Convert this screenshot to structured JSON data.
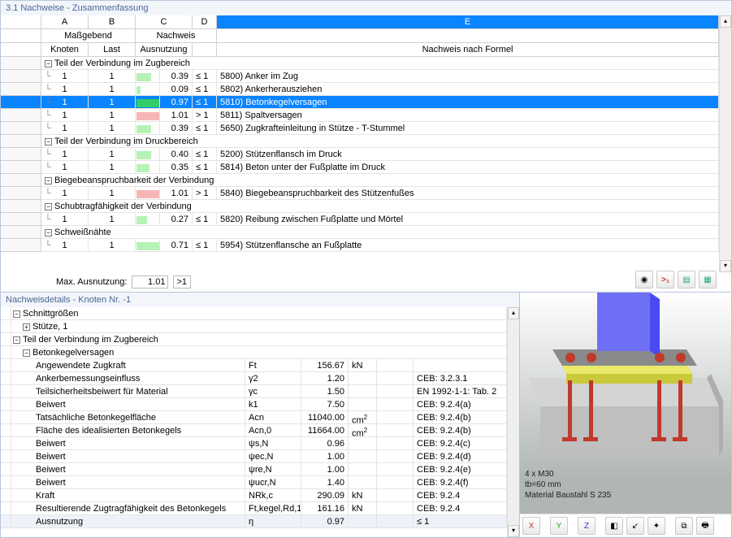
{
  "title": "3.1 Nachweise - Zusammenfassung",
  "cols": {
    "A": "A",
    "B": "B",
    "C": "C",
    "D": "D",
    "E": "E",
    "MaBgebend": "Maßgebend",
    "Nachweis": "Nachweis",
    "Knoten": "Knoten",
    "Last": "Last",
    "Ausnutzung": "Ausnutzung",
    "Formel": "Nachweis nach Formel"
  },
  "groups": [
    {
      "title": "Teil der Verbindung im Zugbereich",
      "rows": [
        {
          "k": "1",
          "l": "1",
          "r": "0.39",
          "c": "≤ 1",
          "d": "5800) Anker im Zug",
          "bar": "green",
          "bw": 18
        },
        {
          "k": "1",
          "l": "1",
          "r": "0.09",
          "c": "≤ 1",
          "d": "5802) Ankerherausziehen",
          "bar": "green",
          "bw": 5
        },
        {
          "k": "1",
          "l": "1",
          "r": "0.97",
          "c": "≤ 1",
          "d": "5810) Betonkegelversagen",
          "bar": "hgreen",
          "bw": 36,
          "sel": true
        },
        {
          "k": "1",
          "l": "1",
          "r": "1.01",
          "c": "> 1",
          "d": "5811) Spaltversagen",
          "bar": "red",
          "bw": 38
        },
        {
          "k": "1",
          "l": "1",
          "r": "0.39",
          "c": "≤ 1",
          "d": "5650) Zugkrafteinleitung in Stütze - T-Stummel",
          "bar": "green",
          "bw": 18
        }
      ]
    },
    {
      "title": "Teil der Verbindung im Druckbereich",
      "rows": [
        {
          "k": "1",
          "l": "1",
          "r": "0.40",
          "c": "≤ 1",
          "d": "5200) Stützenflansch im Druck",
          "bar": "green",
          "bw": 18
        },
        {
          "k": "1",
          "l": "1",
          "r": "0.35",
          "c": "≤ 1",
          "d": "5814) Beton unter der Fußplatte im Druck",
          "bar": "green",
          "bw": 16
        }
      ]
    },
    {
      "title": "Biegebeanspruchbarkeit der Verbindung",
      "rows": [
        {
          "k": "1",
          "l": "1",
          "r": "1.01",
          "c": "> 1",
          "d": "5840) Biegebeanspruchbarkeit des Stützenfußes",
          "bar": "red",
          "bw": 38
        }
      ]
    },
    {
      "title": "Schubtragfähigkeit der Verbindung",
      "rows": [
        {
          "k": "1",
          "l": "1",
          "r": "0.27",
          "c": "≤ 1",
          "d": "5820) Reibung zwischen Fußplatte und Mörtel",
          "bar": "green",
          "bw": 13
        }
      ]
    },
    {
      "title": "Schweißnähte",
      "rows": [
        {
          "k": "1",
          "l": "1",
          "r": "0.71",
          "c": "≤ 1",
          "d": "5954) Stützenflansche an Fußplatte",
          "bar": "green",
          "bw": 30
        }
      ]
    }
  ],
  "max": {
    "label": "Max. Ausnutzung:",
    "val": "1.01",
    "cmp": ">1"
  },
  "details": {
    "title": "Nachweisdetails - Knoten Nr. -1",
    "groups": [
      {
        "h": "Schnittgrößen",
        "rows": [
          {
            "h": "Stütze, 1",
            "tog": "+"
          }
        ]
      },
      {
        "h": "Teil der Verbindung im Zugbereich",
        "rows": []
      },
      {
        "h": "Betonkegelversagen",
        "indent": 1,
        "rows": [
          {
            "n": "Angewendete Zugkraft",
            "s": "Ft",
            "v": "156.67",
            "u": "kN",
            "r": ""
          },
          {
            "n": "Ankerbemessungseinfluss",
            "s": "γ2",
            "v": "1.20",
            "u": "",
            "r": "CEB: 3.2.3.1"
          },
          {
            "n": "Teilsicherheitsbeiwert für Material",
            "s": "γc",
            "v": "1.50",
            "u": "",
            "r": "EN 1992-1-1: Tab. 2"
          },
          {
            "n": "Beiwert",
            "s": "k1",
            "v": "7.50",
            "u": "",
            "r": "CEB: 9.2.4(a)"
          },
          {
            "n": "Tatsächliche Betonkegelfläche",
            "s": "Acn",
            "v": "11040.00",
            "u": "cm²",
            "r": "CEB: 9.2.4(b)"
          },
          {
            "n": "Fläche des idealisierten Betonkegels",
            "s": "Acn,0",
            "v": "11664.00",
            "u": "cm²",
            "r": "CEB: 9.2.4(b)"
          },
          {
            "n": "Beiwert",
            "s": "ψs,N",
            "v": "0.96",
            "u": "",
            "r": "CEB: 9.2.4(c)"
          },
          {
            "n": "Beiwert",
            "s": "ψec,N",
            "v": "1.00",
            "u": "",
            "r": "CEB: 9.2.4(d)"
          },
          {
            "n": "Beiwert",
            "s": "ψre,N",
            "v": "1.00",
            "u": "",
            "r": "CEB: 9.2.4(e)"
          },
          {
            "n": "Beiwert",
            "s": "ψucr,N",
            "v": "1.40",
            "u": "",
            "r": "CEB: 9.2.4(f)"
          },
          {
            "n": "Kraft",
            "s": "NRk,c",
            "v": "290.09",
            "u": "kN",
            "r": "CEB: 9.2.4"
          },
          {
            "n": "Resultierende Zugtragfähigkeit des Betonkegels",
            "s": "Ft,kegel,Rd,1",
            "v": "161.16",
            "u": "kN",
            "r": "CEB: 9.2.4"
          },
          {
            "n": "Ausnutzung",
            "s": "η",
            "v": "0.97",
            "u": "",
            "r": "≤ 1",
            "hl": true
          }
        ]
      }
    ]
  },
  "viewer": {
    "l1": "4 x M30",
    "l2": "tb=60 mm",
    "l3": "Material Baustahl S 235"
  }
}
